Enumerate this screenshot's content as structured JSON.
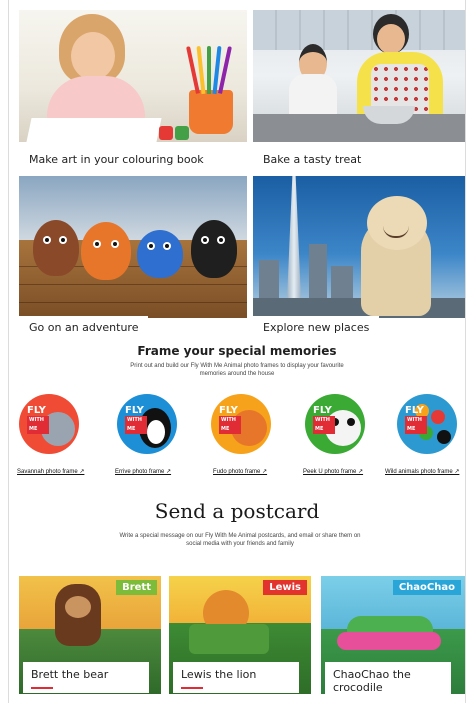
{
  "tiles": [
    {
      "caption": "Make art in your colouring book"
    },
    {
      "caption": "Bake a tasty treat"
    },
    {
      "caption": "Go on an adventure"
    },
    {
      "caption": "Explore new places"
    }
  ],
  "frames": {
    "title": "Frame your special memories",
    "subtitle": "Print out and build our Fly With Me Animal photo frames to display your favourite memories around the house",
    "badge_text": "FLY",
    "badge_small": "WITH ME",
    "items": [
      {
        "label": "Savannah photo frame ↗",
        "color": "#f04b34"
      },
      {
        "label": "Errive photo frame ↗",
        "color": "#1c8fd6"
      },
      {
        "label": "Fudo photo frame ↗",
        "color": "#f7a21b"
      },
      {
        "label": "Peek U photo frame ↗",
        "color": "#3aaa35"
      },
      {
        "label": "Wild animals photo frame ↗",
        "color": "#2c9ad1"
      }
    ]
  },
  "postcard": {
    "title": "Send a postcard",
    "subtitle": "Write a special message on our Fly With Me Animal postcards, and email or share them on social media with your friends and family",
    "cards": [
      {
        "tag": "Brett",
        "caption": "Brett the bear",
        "tag_color": "#7dbb3a"
      },
      {
        "tag": "Lewis",
        "caption": "Lewis the lion",
        "tag_color": "#e2332f"
      },
      {
        "tag": "ChaoChao",
        "caption": "ChaoChao the crocodile",
        "tag_color": "#2aa5d8"
      }
    ]
  }
}
